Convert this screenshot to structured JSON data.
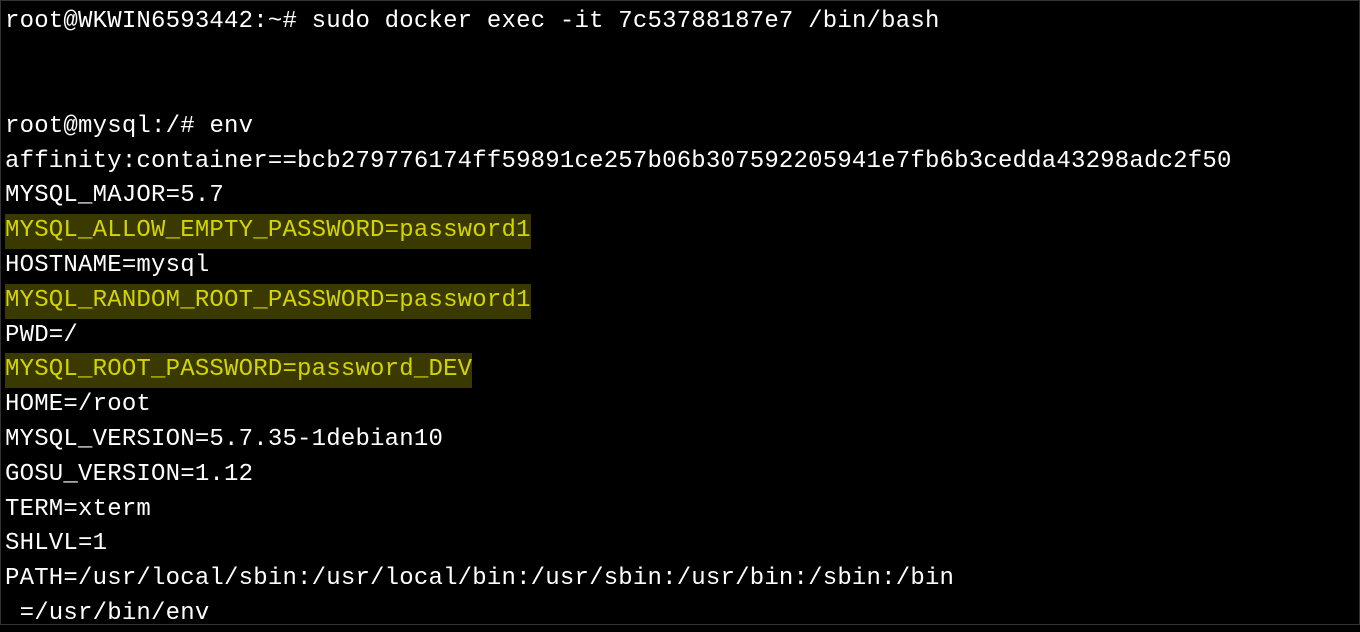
{
  "terminal": {
    "prompt1": "root@WKWIN6593442:~# ",
    "command1": "sudo docker exec -it 7c53788187e7 /bin/bash",
    "prompt2": "root@mysql:/# ",
    "command2": "env",
    "env_lines": {
      "affinity": "affinity:container==bcb279776174ff59891ce257b06b307592205941e7fb6b3cedda43298adc2f50",
      "mysql_major": "MYSQL_MAJOR=5.7",
      "mysql_allow_empty": "MYSQL_ALLOW_EMPTY_PASSWORD=password1",
      "hostname": "HOSTNAME=mysql",
      "mysql_random_root": "MYSQL_RANDOM_ROOT_PASSWORD=password1",
      "pwd": "PWD=/",
      "mysql_root_password": "MYSQL_ROOT_PASSWORD=password_DEV",
      "home": "HOME=/root",
      "mysql_version": "MYSQL_VERSION=5.7.35-1debian10",
      "gosu_version": "GOSU_VERSION=1.12",
      "term": "TERM=xterm",
      "shlvl": "SHLVL=1",
      "path": "PATH=/usr/local/sbin:/usr/local/bin:/usr/sbin:/usr/bin:/sbin:/bin",
      "underscore": " =/usr/bin/env"
    }
  }
}
